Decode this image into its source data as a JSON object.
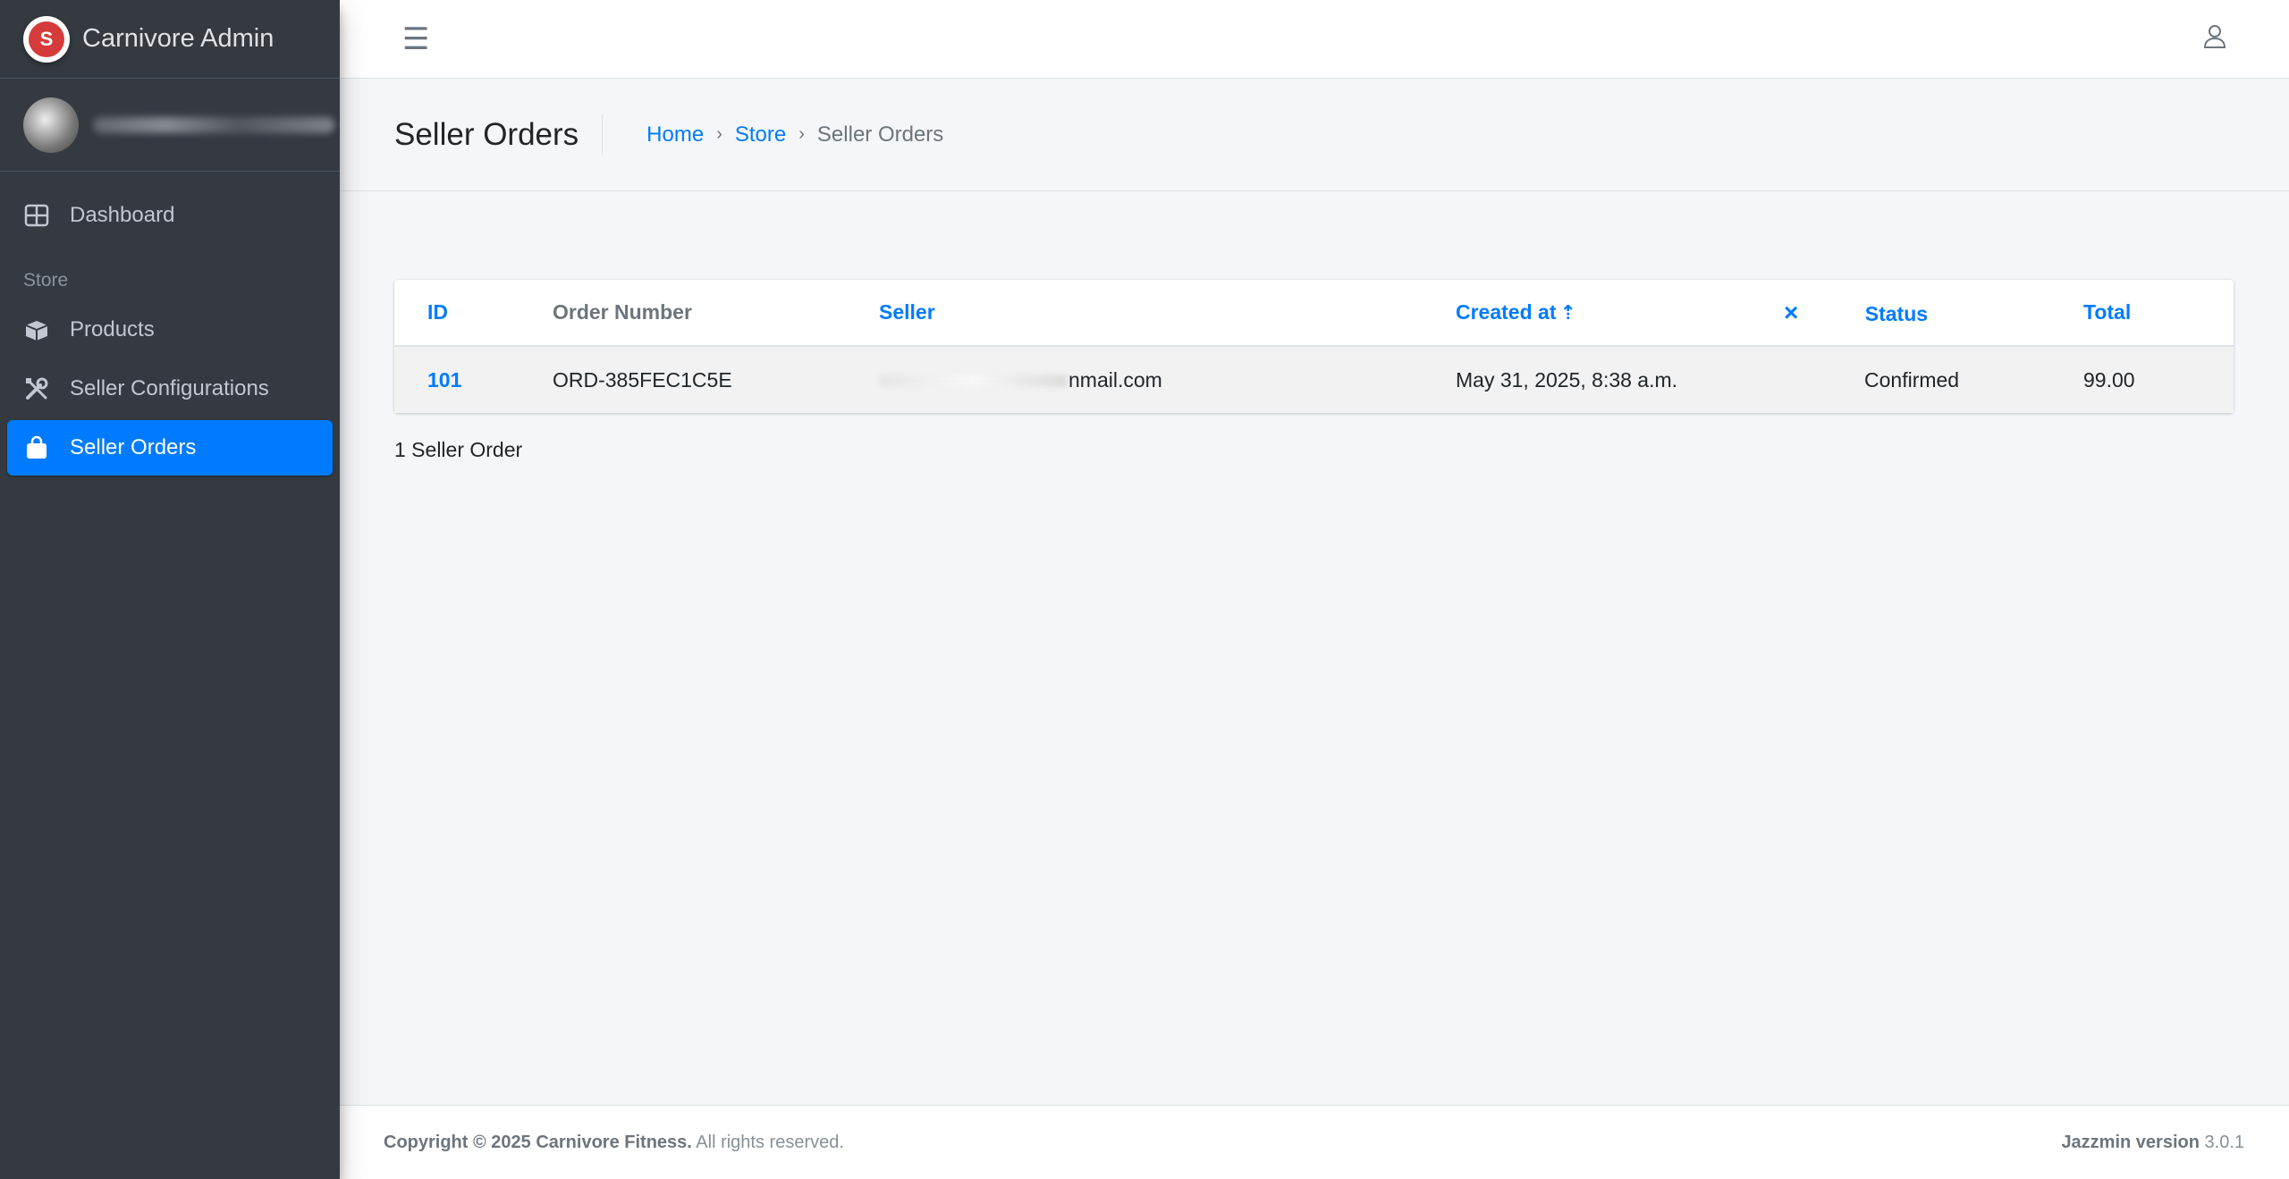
{
  "brand": {
    "name": "Carnivore Admin",
    "logo_letter": "S"
  },
  "sidebar": {
    "items": [
      {
        "label": "Dashboard",
        "icon": "dashboard-icon",
        "active": false
      },
      {
        "label": "Products",
        "icon": "boxes-icon",
        "active": false
      },
      {
        "label": "Seller Configurations",
        "icon": "tools-icon",
        "active": false
      },
      {
        "label": "Seller Orders",
        "icon": "shopping-bag-icon",
        "active": true
      }
    ],
    "section_store": "Store"
  },
  "topbar": {
    "menu_icon": "hamburger-icon",
    "user_icon": "user-icon"
  },
  "header": {
    "title": "Seller Orders",
    "breadcrumb": [
      "Home",
      "Store",
      "Seller Orders"
    ]
  },
  "table": {
    "columns": [
      "ID",
      "Order Number",
      "Seller",
      "Created at",
      "Status",
      "Total"
    ],
    "rows": [
      {
        "id": "101",
        "order_number": "ORD-385FEC1C5E",
        "seller_visible": "nmail.com",
        "created_at": "May 31, 2025, 8:38 a.m.",
        "status": "Confirmed",
        "total": "99.00"
      }
    ],
    "clear_sort_icon": "close-icon"
  },
  "result_count": "1 Seller Order",
  "footer": {
    "copyright_bold": "Copyright © 2025 Carnivore Fitness.",
    "copyright_rest": " All rights reserved.",
    "version_label": "Jazzmin version",
    "version_number": " 3.0.1"
  },
  "colors": {
    "sidebar": "#343a40",
    "accent": "#007bff",
    "background": "#f4f6f9"
  }
}
